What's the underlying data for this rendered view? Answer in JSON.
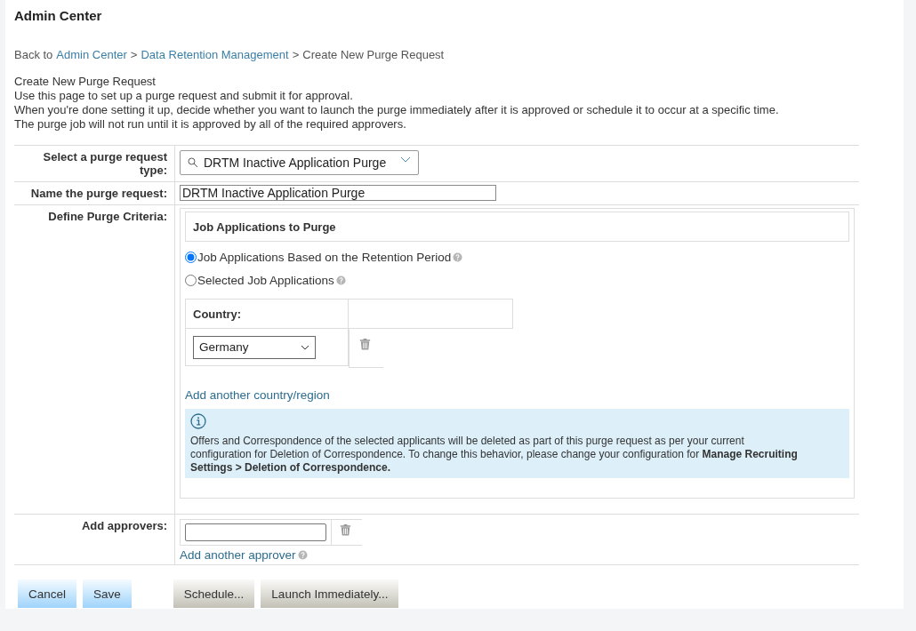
{
  "header": {
    "title": "Admin Center"
  },
  "breadcrumb": {
    "prefix": "Back to",
    "links": [
      "Admin Center",
      "Data Retention Management"
    ],
    "separator": ">",
    "current": "Create New Purge Request"
  },
  "intro": [
    "Create New Purge Request",
    "Use this page to set up a purge request and submit it for approval.",
    "When you're done setting it up, decide whether you want to launch the purge immediately after it is approved or schedule it to occur at a specific time.",
    "The purge job will not run until it is approved by all of the required approvers."
  ],
  "form": {
    "request_type": {
      "label": "Select a purge request type:",
      "value": "DRTM Inactive Application Purge"
    },
    "name": {
      "label": "Name the purge request:",
      "value": "DRTM Inactive Application Purge"
    },
    "criteria": {
      "label": "Define Purge Criteria:",
      "section_title": "Job Applications to Purge",
      "options": [
        {
          "label": "Job Applications Based on the Retention Period",
          "selected": true
        },
        {
          "label": "Selected Job Applications",
          "selected": false
        }
      ],
      "country_label": "Country:",
      "country_value": "Germany",
      "add_country_link": "Add another country/region",
      "info_text": "Offers and Correspondence of the selected applicants will be deleted as part of this purge request as per your current configuration for Deletion of Correspondence. To change this behavior, please change your configuration for **Manage Recruiting Settings > Deletion of Correspondence.**"
    },
    "approvers": {
      "label": "Add approvers:",
      "add_link": "Add another approver"
    }
  },
  "buttons": [
    {
      "label": "Cancel",
      "kind": "primary"
    },
    {
      "label": "Save",
      "kind": "primary"
    },
    {
      "label": "Schedule...",
      "kind": "secondary"
    },
    {
      "label": "Launch Immediately...",
      "kind": "secondary"
    }
  ]
}
